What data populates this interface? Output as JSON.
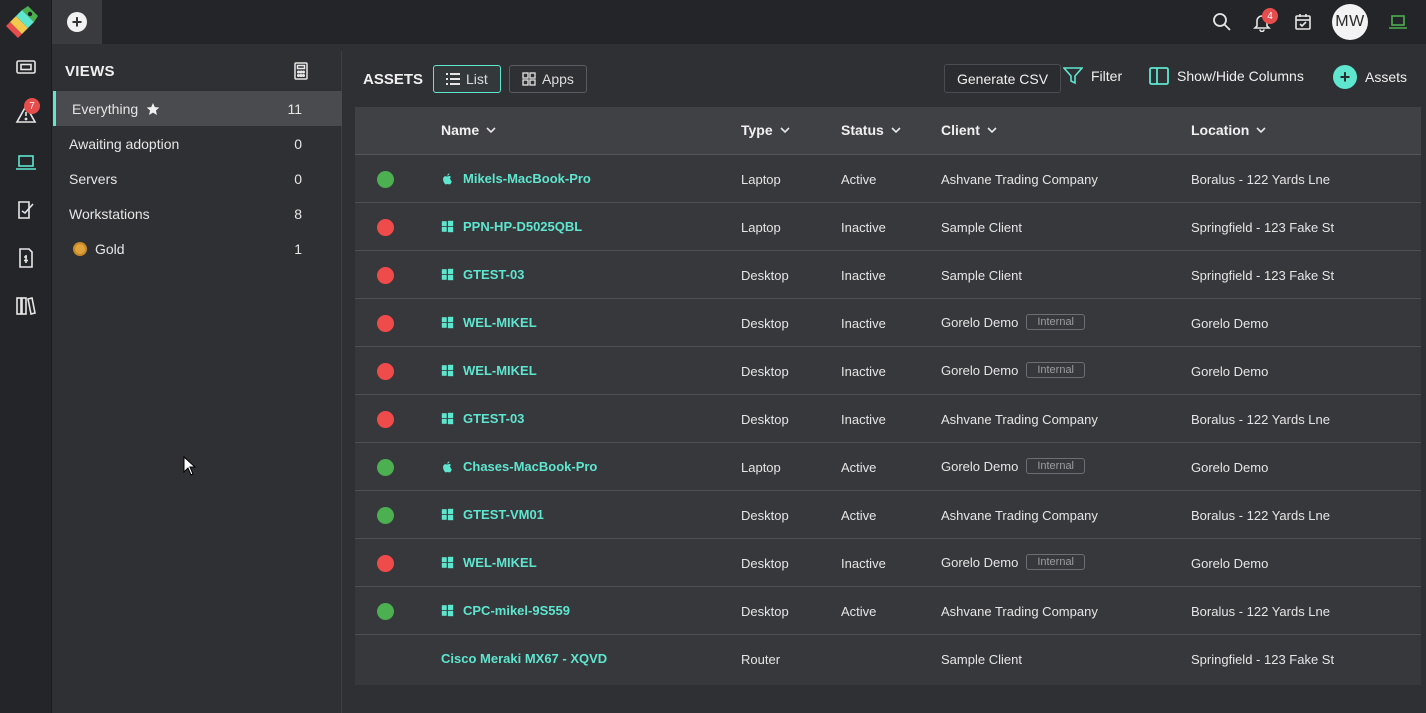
{
  "rail": {
    "items": [
      {
        "name": "tickets-icon"
      },
      {
        "name": "alerts-icon",
        "badge": "7"
      },
      {
        "name": "laptop-icon",
        "active": true
      },
      {
        "name": "contracts-icon"
      },
      {
        "name": "billing-icon"
      },
      {
        "name": "library-icon"
      }
    ]
  },
  "topbar": {
    "add_tab": "+",
    "notifications_badge": "4",
    "avatar_initials": "MW"
  },
  "views": {
    "title": "VIEWS",
    "items": [
      {
        "label": "Everything",
        "count": "11",
        "active": true,
        "starred": true
      },
      {
        "label": "Awaiting adoption",
        "count": "0"
      },
      {
        "label": "Servers",
        "count": "0"
      },
      {
        "label": "Workstations",
        "count": "8"
      },
      {
        "label": "Gold",
        "count": "1",
        "dot": "#e0a23b"
      }
    ]
  },
  "assets": {
    "title": "ASSETS",
    "list_label": "List",
    "apps_label": "Apps",
    "csv_label": "Generate CSV",
    "filter_label": "Filter",
    "columns_label": "Show/Hide Columns",
    "add_label": "Assets"
  },
  "table": {
    "columns": [
      "Name",
      "Type",
      "Status",
      "Client",
      "Location"
    ],
    "rows": [
      {
        "status": "green",
        "os": "apple",
        "name": "Mikels-MacBook-Pro",
        "type": "Laptop",
        "state": "Active",
        "client": "Ashvane Trading Company",
        "tag": "",
        "location": "Boralus - 122 Yards Lne"
      },
      {
        "status": "red",
        "os": "windows",
        "name": "PPN-HP-D5025QBL",
        "type": "Laptop",
        "state": "Inactive",
        "client": "Sample Client",
        "tag": "",
        "location": "Springfield - 123 Fake St"
      },
      {
        "status": "red",
        "os": "windows",
        "name": "GTEST-03",
        "type": "Desktop",
        "state": "Inactive",
        "client": "Sample Client",
        "tag": "",
        "location": "Springfield - 123 Fake St"
      },
      {
        "status": "red",
        "os": "windows",
        "name": "WEL-MIKEL",
        "type": "Desktop",
        "state": "Inactive",
        "client": "Gorelo Demo",
        "tag": "Internal",
        "location": "Gorelo Demo"
      },
      {
        "status": "red",
        "os": "windows",
        "name": "WEL-MIKEL",
        "type": "Desktop",
        "state": "Inactive",
        "client": "Gorelo Demo",
        "tag": "Internal",
        "location": "Gorelo Demo"
      },
      {
        "status": "red",
        "os": "windows",
        "name": "GTEST-03",
        "type": "Desktop",
        "state": "Inactive",
        "client": "Ashvane Trading Company",
        "tag": "",
        "location": "Boralus - 122 Yards Lne"
      },
      {
        "status": "green",
        "os": "apple",
        "name": "Chases-MacBook-Pro",
        "type": "Laptop",
        "state": "Active",
        "client": "Gorelo Demo",
        "tag": "Internal",
        "location": "Gorelo Demo"
      },
      {
        "status": "green",
        "os": "windows",
        "name": "GTEST-VM01",
        "type": "Desktop",
        "state": "Active",
        "client": "Ashvane Trading Company",
        "tag": "",
        "location": "Boralus - 122 Yards Lne"
      },
      {
        "status": "red",
        "os": "windows",
        "name": "WEL-MIKEL",
        "type": "Desktop",
        "state": "Inactive",
        "client": "Gorelo Demo",
        "tag": "Internal",
        "location": "Gorelo Demo"
      },
      {
        "status": "green",
        "os": "windows",
        "name": "CPC-mikel-9S559",
        "type": "Desktop",
        "state": "Active",
        "client": "Ashvane Trading Company",
        "tag": "",
        "location": "Boralus - 122 Yards Lne"
      },
      {
        "status": "",
        "os": "",
        "name": "Cisco Meraki MX67 - XQVD",
        "type": "Router",
        "state": "",
        "client": "Sample Client",
        "tag": "",
        "location": "Springfield - 123 Fake St"
      }
    ]
  },
  "colors": {
    "accent": "#5ee6cf",
    "active": "#4caf50",
    "inactive": "#f04b4b"
  }
}
